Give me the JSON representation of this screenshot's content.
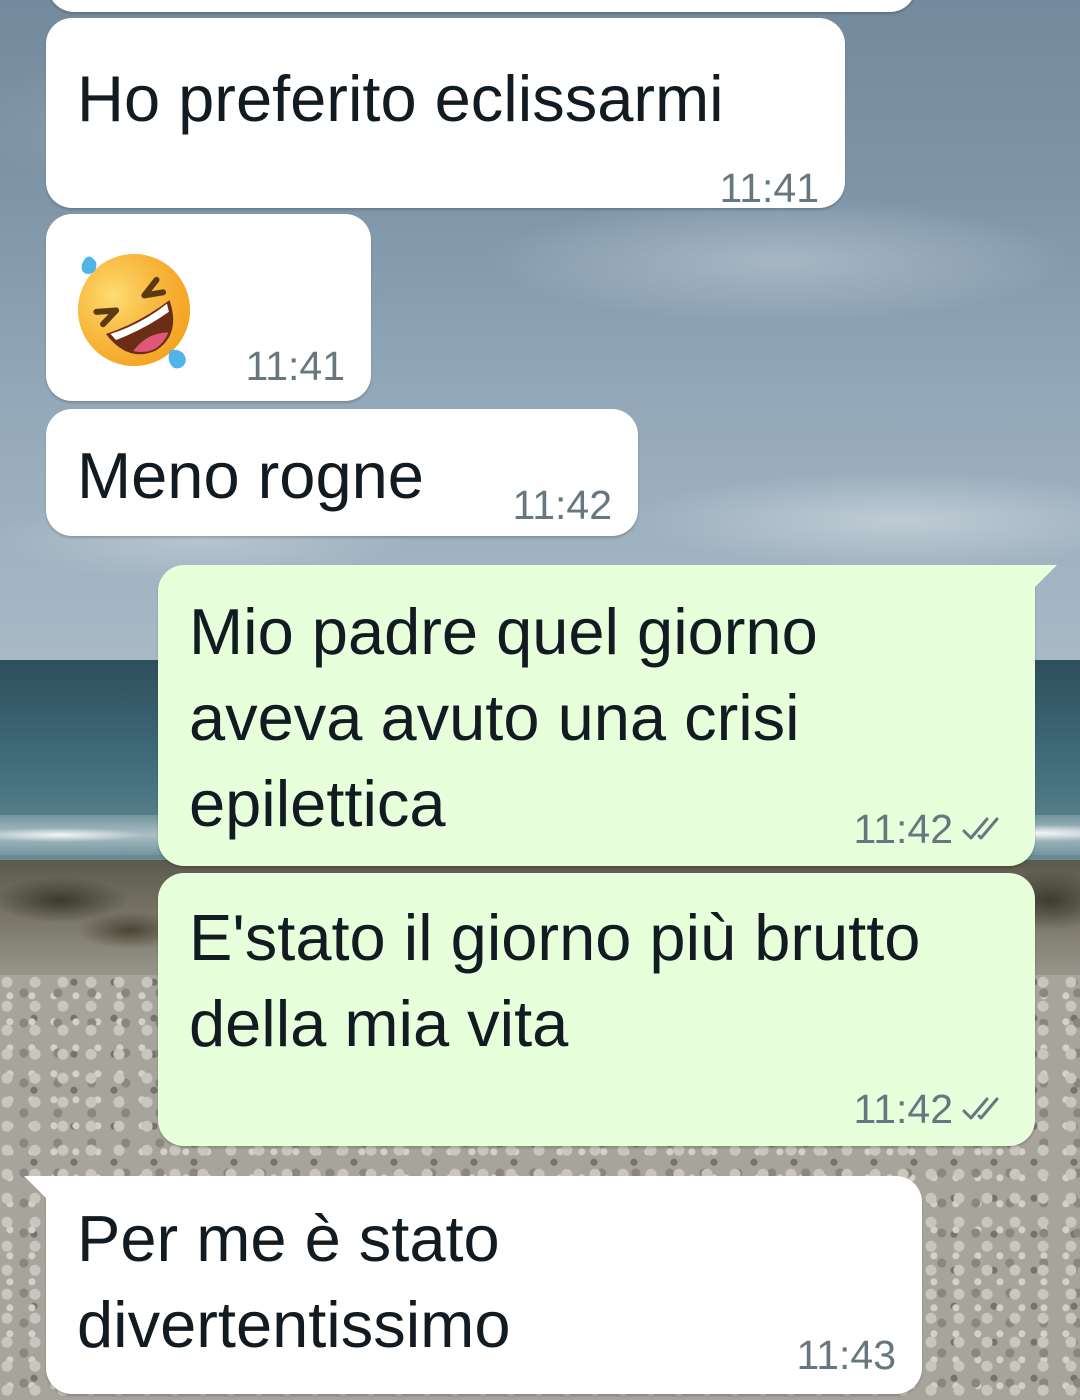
{
  "messages": [
    {
      "direction": "incoming",
      "text": "Ho preferito eclissarmi",
      "time": "11:41"
    },
    {
      "direction": "incoming",
      "emoji": "rolling-on-the-floor-laughing",
      "time": "11:41"
    },
    {
      "direction": "incoming",
      "text": "Meno rogne",
      "time": "11:42"
    },
    {
      "direction": "outgoing",
      "text": "Mio padre quel giorno aveva avuto una crisi epilettica",
      "time": "11:42",
      "status_icon": "double-check-icon"
    },
    {
      "direction": "outgoing",
      "text": "E'stato il giorno più brutto della mia vita",
      "time": "11:42",
      "status_icon": "double-check-icon"
    },
    {
      "direction": "incoming",
      "text": "Per me è stato divertentissimo",
      "time": "11:43"
    }
  ],
  "colors": {
    "incoming_bubble": "#ffffff",
    "outgoing_bubble": "#e7ffdb",
    "message_text": "#111b21",
    "timestamp_text": "#667781",
    "tick_color": "#667781"
  },
  "wallpaper": "beach-photo"
}
